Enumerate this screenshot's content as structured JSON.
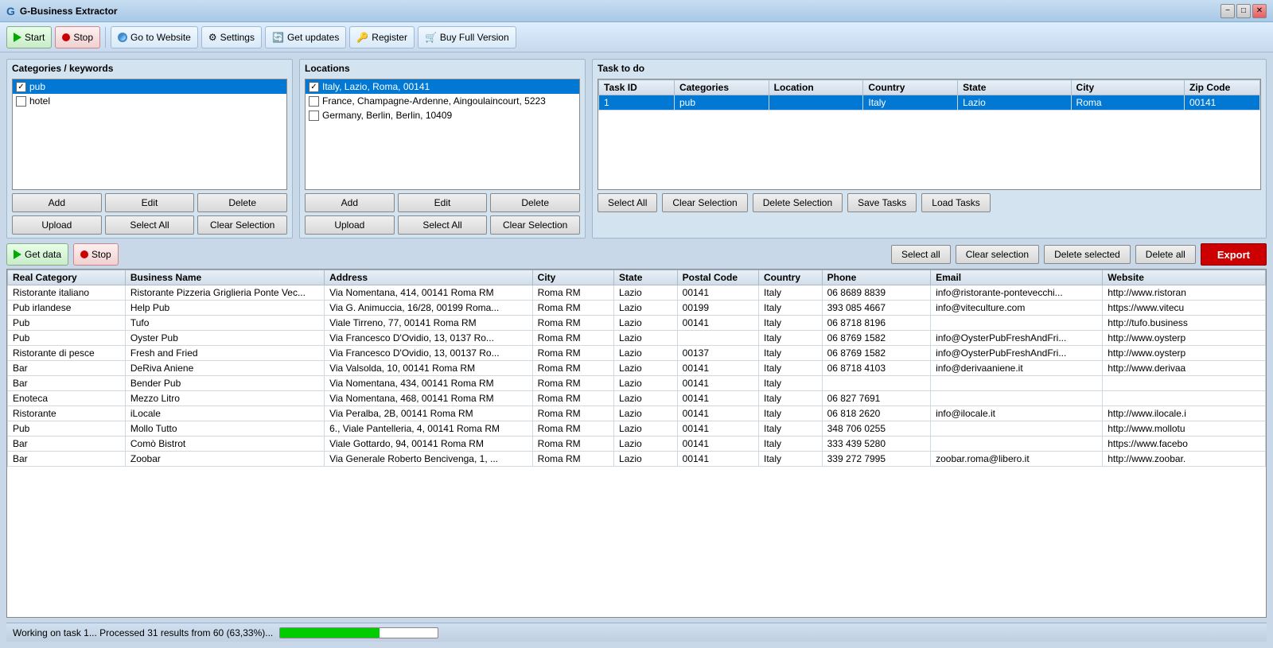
{
  "titleBar": {
    "title": "G-Business Extractor",
    "icon": "G",
    "controls": [
      "minimize",
      "maximize",
      "close"
    ]
  },
  "toolbar": {
    "buttons": [
      {
        "id": "start",
        "label": "Start",
        "icon": "play"
      },
      {
        "id": "stop",
        "label": "Stop",
        "icon": "stop"
      },
      {
        "id": "website",
        "label": "Go to Website",
        "icon": "globe"
      },
      {
        "id": "settings",
        "label": "Settings",
        "icon": "gear"
      },
      {
        "id": "updates",
        "label": "Get updates",
        "icon": "update"
      },
      {
        "id": "register",
        "label": "Register",
        "icon": "key"
      },
      {
        "id": "buyfull",
        "label": "Buy Full Version",
        "icon": "cart"
      }
    ]
  },
  "categories": {
    "title": "Categories / keywords",
    "items": [
      {
        "id": 1,
        "label": "pub",
        "checked": true,
        "selected": true
      },
      {
        "id": 2,
        "label": "hotel",
        "checked": false,
        "selected": false
      }
    ],
    "buttons": {
      "add": "Add",
      "edit": "Edit",
      "delete": "Delete",
      "upload": "Upload",
      "selectAll": "Select All",
      "clearSelection": "Clear Selection"
    }
  },
  "locations": {
    "title": "Locations",
    "items": [
      {
        "id": 1,
        "label": "Italy, Lazio, Roma, 00141",
        "checked": true,
        "selected": true
      },
      {
        "id": 2,
        "label": "France, Champagne-Ardenne, Aingoulaincourt, 5223",
        "checked": false,
        "selected": false
      },
      {
        "id": 3,
        "label": "Germany, Berlin, Berlin, 10409",
        "checked": false,
        "selected": false
      }
    ],
    "buttons": {
      "add": "Add",
      "edit": "Edit",
      "delete": "Delete",
      "upload": "Upload",
      "selectAll": "Select All",
      "clearSelection": "Clear Selection"
    }
  },
  "tasks": {
    "title": "Task to do",
    "columns": [
      "Task ID",
      "Categories",
      "Location",
      "Country",
      "State",
      "City",
      "Zip Code"
    ],
    "rows": [
      {
        "taskId": "1",
        "categories": "pub",
        "location": "",
        "country": "Italy",
        "state": "Lazio",
        "city": "Roma",
        "zipCode": "00141",
        "selected": true
      }
    ],
    "buttons": {
      "selectAll": "Select All",
      "clearSelection": "Clear Selection",
      "deleteSelection": "Delete Selection",
      "saveTasks": "Save Tasks",
      "loadTasks": "Load Tasks"
    }
  },
  "actions": {
    "getData": "Get data",
    "stop": "Stop",
    "selectAll": "Select all",
    "clearSelection": "Clear selection",
    "deleteSelected": "Delete selected",
    "deleteAll": "Delete all",
    "export": "Export"
  },
  "dataTable": {
    "columns": [
      "Real Category",
      "Business Name",
      "Address",
      "City",
      "State",
      "Postal Code",
      "Country",
      "Phone",
      "Email",
      "Website"
    ],
    "rows": [
      {
        "realCategory": "Ristorante italiano",
        "businessName": "Ristorante Pizzeria Griglieria Ponte Vec...",
        "address": "Via Nomentana, 414, 00141 Roma RM",
        "city": "Roma RM",
        "state": "Lazio",
        "postalCode": "00141",
        "country": "Italy",
        "phone": "06 8689 8839",
        "email": "info@ristorante-pontevecchi...",
        "website": "http://www.ristoran"
      },
      {
        "realCategory": "Pub irlandese",
        "businessName": "Help Pub",
        "address": "Via G. Animuccia, 16/28, 00199 Roma...",
        "city": "Roma RM",
        "state": "Lazio",
        "postalCode": "00199",
        "country": "Italy",
        "phone": "393 085 4667",
        "email": "info@viteculture.com",
        "website": "https://www.vitecu"
      },
      {
        "realCategory": "Pub",
        "businessName": "Tufo",
        "address": "Viale Tirreno, 77, 00141 Roma RM",
        "city": "Roma RM",
        "state": "Lazio",
        "postalCode": "00141",
        "country": "Italy",
        "phone": "06 8718 8196",
        "email": "",
        "website": "http://tufo.business"
      },
      {
        "realCategory": "Pub",
        "businessName": "Oyster Pub",
        "address": "Via Francesco D'Ovidio, 13, 0137 Ro...",
        "city": "Roma RM",
        "state": "Lazio",
        "postalCode": "",
        "country": "Italy",
        "phone": "06 8769 1582",
        "email": "info@OysterPubFreshAndFri...",
        "website": "http://www.oysterp"
      },
      {
        "realCategory": "Ristorante di pesce",
        "businessName": "Fresh and Fried",
        "address": "Via Francesco D'Ovidio, 13, 00137 Ro...",
        "city": "Roma RM",
        "state": "Lazio",
        "postalCode": "00137",
        "country": "Italy",
        "phone": "06 8769 1582",
        "email": "info@OysterPubFreshAndFri...",
        "website": "http://www.oysterp"
      },
      {
        "realCategory": "Bar",
        "businessName": "DeRiva Aniene",
        "address": "Via Valsolda, 10, 00141 Roma RM",
        "city": "Roma RM",
        "state": "Lazio",
        "postalCode": "00141",
        "country": "Italy",
        "phone": "06 8718 4103",
        "email": "info@derivaaniene.it",
        "website": "http://www.derivaa"
      },
      {
        "realCategory": "Bar",
        "businessName": "Bender Pub",
        "address": "Via Nomentana, 434, 00141 Roma RM",
        "city": "Roma RM",
        "state": "Lazio",
        "postalCode": "00141",
        "country": "Italy",
        "phone": "",
        "email": "",
        "website": ""
      },
      {
        "realCategory": "Enoteca",
        "businessName": "Mezzo Litro",
        "address": "Via Nomentana, 468, 00141 Roma RM",
        "city": "Roma RM",
        "state": "Lazio",
        "postalCode": "00141",
        "country": "Italy",
        "phone": "06 827 7691",
        "email": "",
        "website": ""
      },
      {
        "realCategory": "Ristorante",
        "businessName": "iLocale",
        "address": "Via Peralba, 2B, 00141 Roma RM",
        "city": "Roma RM",
        "state": "Lazio",
        "postalCode": "00141",
        "country": "Italy",
        "phone": "06 818 2620",
        "email": "info@ilocale.it",
        "website": "http://www.ilocale.i"
      },
      {
        "realCategory": "Pub",
        "businessName": "Mollo Tutto",
        "address": "6., Viale Pantelleria, 4, 00141 Roma RM",
        "city": "Roma RM",
        "state": "Lazio",
        "postalCode": "00141",
        "country": "Italy",
        "phone": "348 706 0255",
        "email": "",
        "website": "http://www.mollotu"
      },
      {
        "realCategory": "Bar",
        "businessName": "Comò Bistrot",
        "address": "Viale Gottardo, 94, 00141 Roma RM",
        "city": "Roma RM",
        "state": "Lazio",
        "postalCode": "00141",
        "country": "Italy",
        "phone": "333 439 5280",
        "email": "",
        "website": "https://www.facebo"
      },
      {
        "realCategory": "Bar",
        "businessName": "Zoobar",
        "address": "Via Generale Roberto Bencivenga, 1, ...",
        "city": "Roma RM",
        "state": "Lazio",
        "postalCode": "00141",
        "country": "Italy",
        "phone": "339 272 7995",
        "email": "zoobar.roma@libero.it",
        "website": "http://www.zoobar."
      }
    ]
  },
  "statusBar": {
    "text": "Working on task 1... Processed 31 results from 60 (63,33%)...",
    "progress": 63
  }
}
